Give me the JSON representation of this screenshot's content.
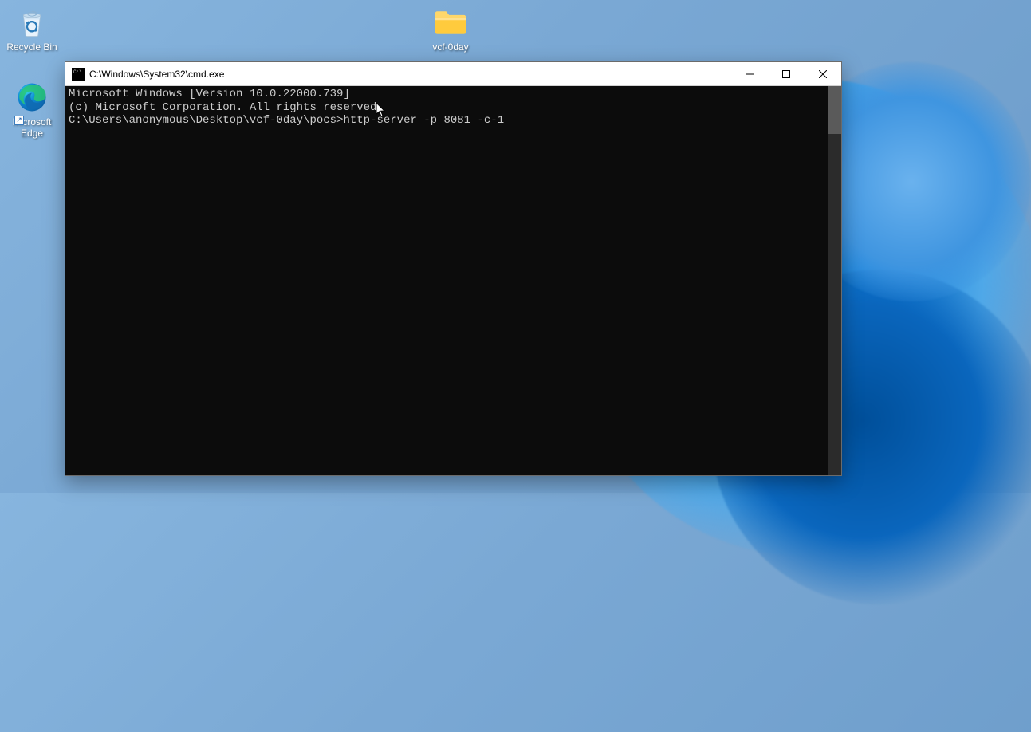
{
  "desktop": {
    "icons": {
      "recycle_bin": {
        "label": "Recycle Bin"
      },
      "edge": {
        "label": "Microsoft\nEdge"
      },
      "folder": {
        "label": "vcf-0day"
      }
    }
  },
  "cmd_window": {
    "title": "C:\\Windows\\System32\\cmd.exe"
  },
  "terminal": {
    "line1": "Microsoft Windows [Version 10.0.22000.739]",
    "line2": "(c) Microsoft Corporation. All rights reserved.",
    "blank": "",
    "prompt_path": "C:\\Users\\anonymous\\Desktop\\vcf-0day\\pocs>",
    "command": "http-server -p 8081 -c-1"
  }
}
